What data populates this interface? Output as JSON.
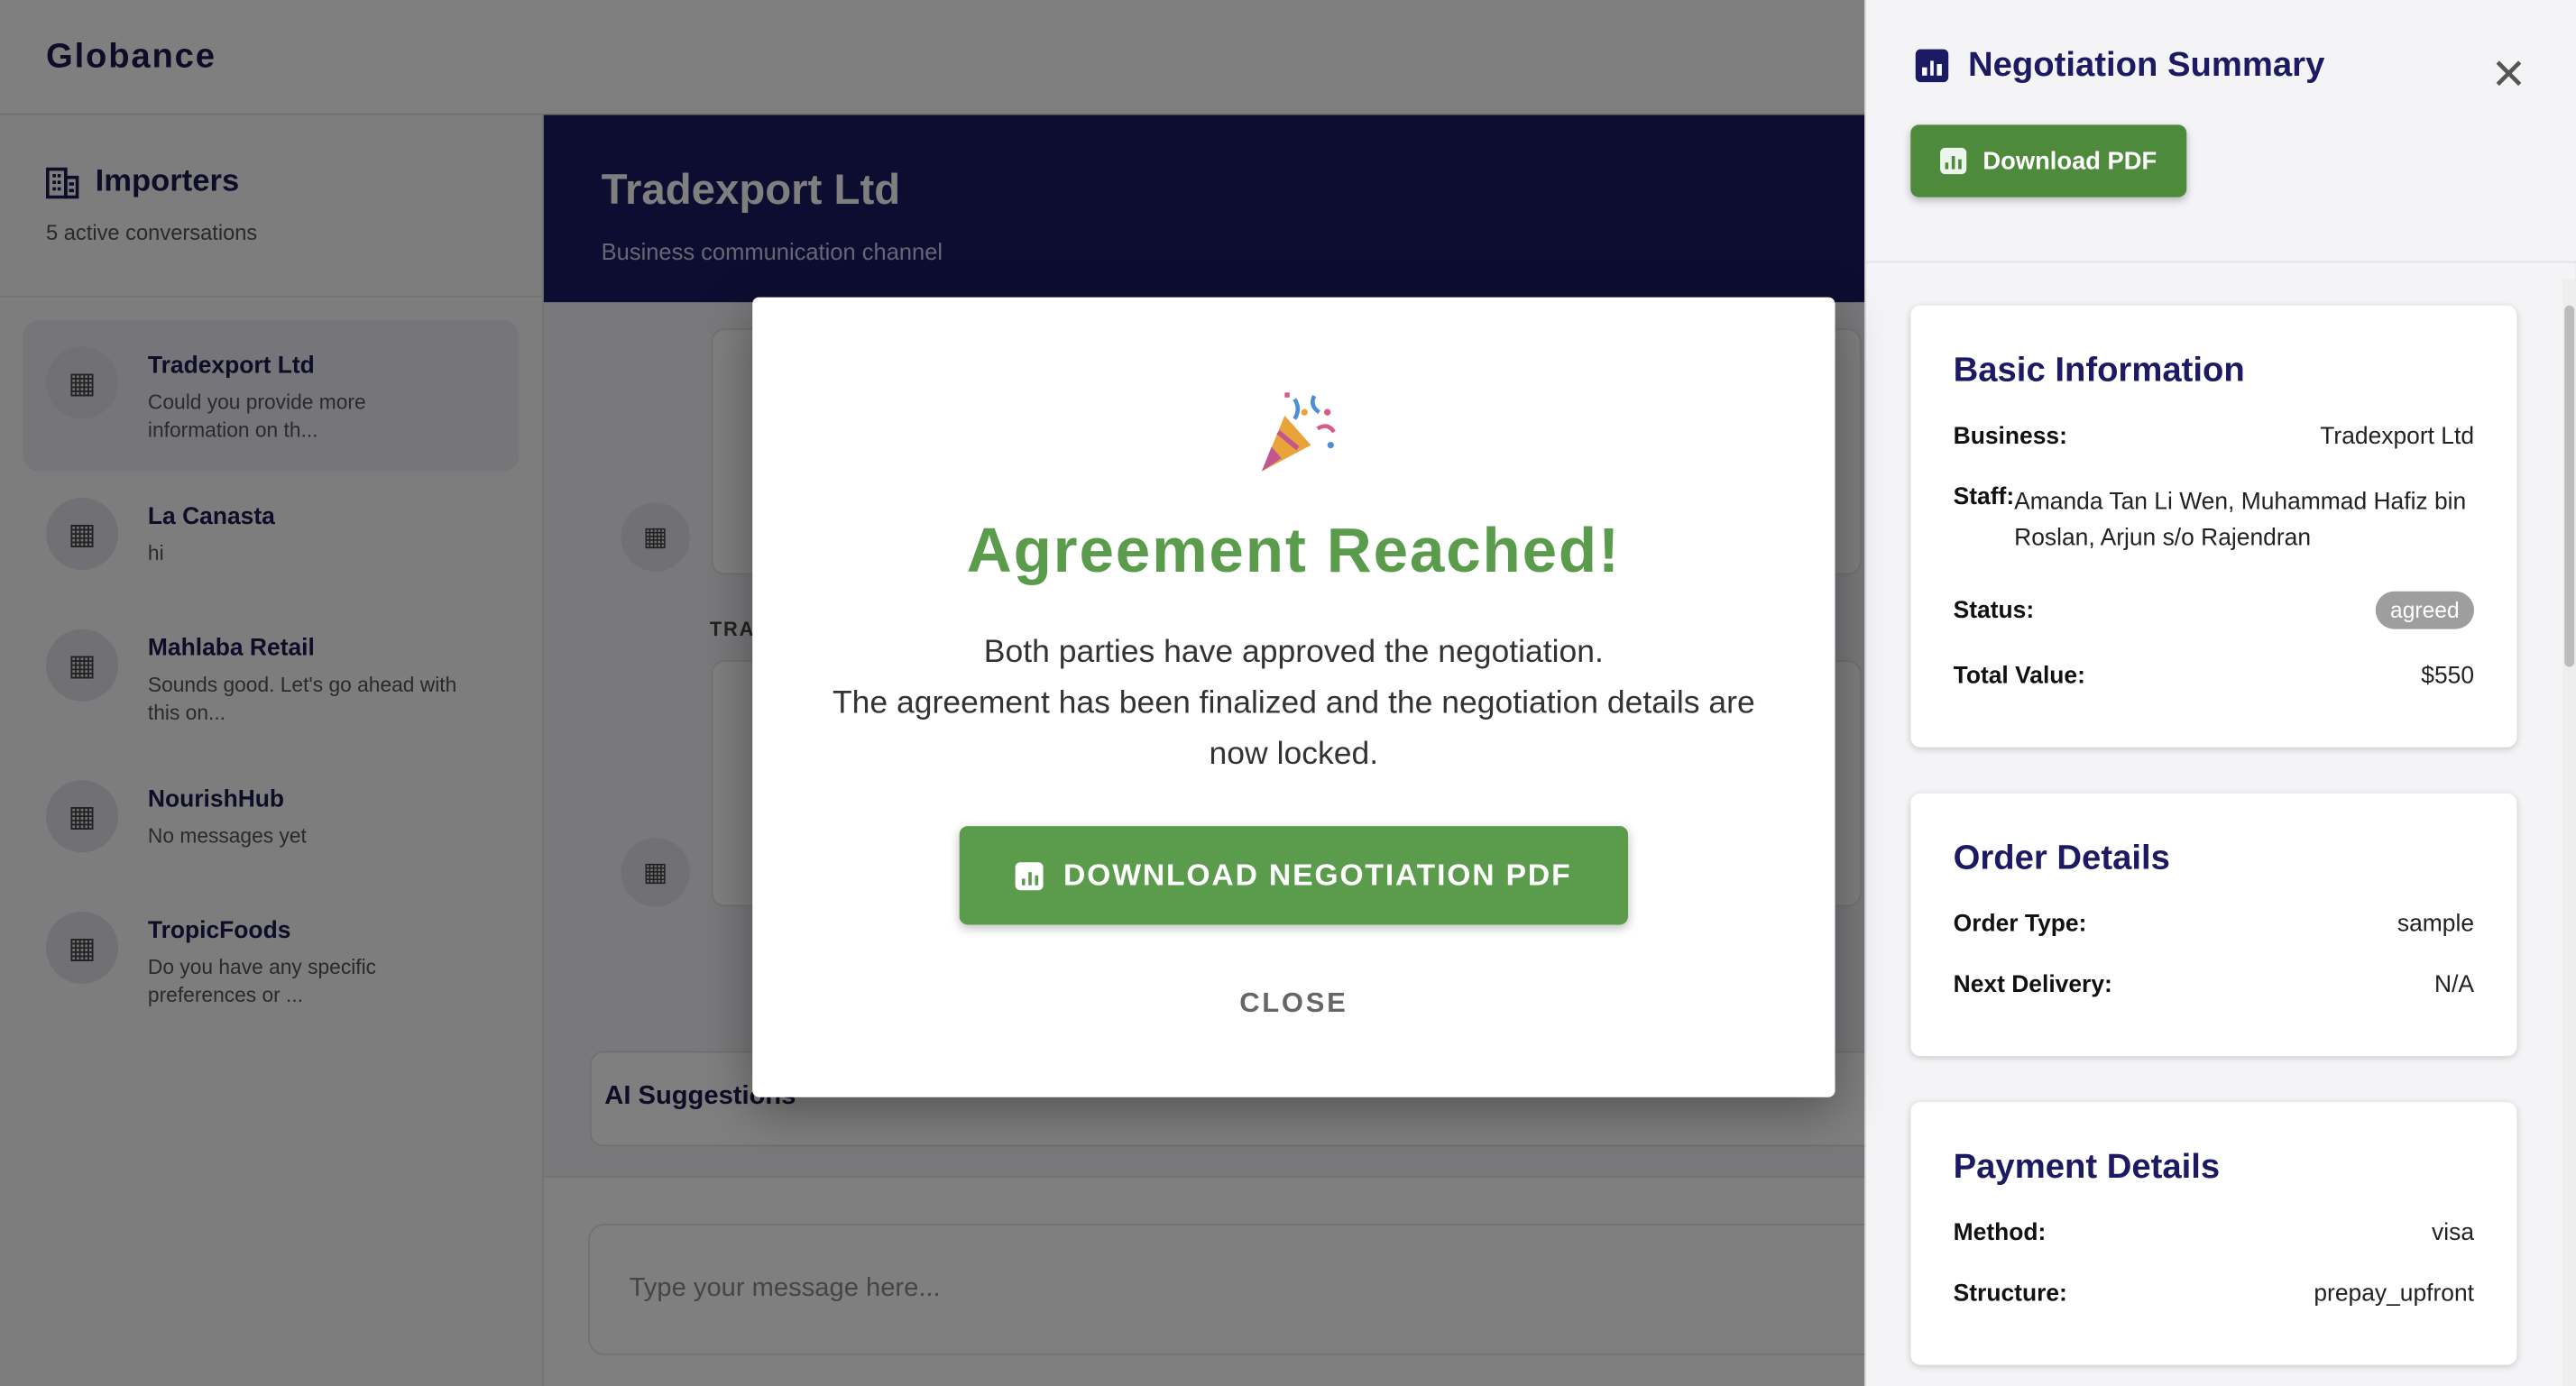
{
  "app": {
    "brand": "Globance"
  },
  "sidebar": {
    "title": "Importers",
    "subtitle": "5 active conversations",
    "conversations": [
      {
        "name": "Tradexport Ltd",
        "preview": "Could you provide more information on th..."
      },
      {
        "name": "La Canasta",
        "preview": "hi"
      },
      {
        "name": "Mahlaba Retail",
        "preview": "Sounds good. Let's go ahead with this on..."
      },
      {
        "name": "NourishHub",
        "preview": "No messages yet"
      },
      {
        "name": "TropicFoods",
        "preview": "Do you have any specific preferences or ..."
      }
    ]
  },
  "chat": {
    "title": "Tradexport Ltd",
    "subtitle": "Business communication channel",
    "sender_tag": "TRA",
    "ai_suggestions_label": "AI Suggestions",
    "input_placeholder": "Type your message here..."
  },
  "drawer": {
    "title": "Negotiation Summary",
    "download_label": "Download PDF",
    "basic": {
      "title": "Basic Information",
      "business_label": "Business:",
      "business_value": "Tradexport Ltd",
      "staff_label": "Staff:",
      "staff_value": "Amanda Tan Li Wen, Muhammad Hafiz bin Roslan, Arjun s/o Rajendran",
      "status_label": "Status:",
      "status_value": "agreed",
      "total_label": "Total Value:",
      "total_value": "$550"
    },
    "order": {
      "title": "Order Details",
      "type_label": "Order Type:",
      "type_value": "sample",
      "delivery_label": "Next Delivery:",
      "delivery_value": "N/A"
    },
    "payment": {
      "title": "Payment Details",
      "method_label": "Method:",
      "method_value": "visa",
      "structure_label": "Structure:",
      "structure_value": "prepay_upfront"
    }
  },
  "modal": {
    "title": "Agreement Reached!",
    "line1": "Both parties have approved the negotiation.",
    "line2": "The agreement has been finalized and the negotiation details are now locked.",
    "download_label": "DOWNLOAD NEGOTIATION PDF",
    "close_label": "CLOSE"
  },
  "colors": {
    "primary": "#1b1a63",
    "success": "#5b9c4c",
    "badge": "#9e9e9e"
  },
  "icons": [
    "building-icon",
    "chart-icon",
    "close-icon",
    "party-popper-icon"
  ]
}
